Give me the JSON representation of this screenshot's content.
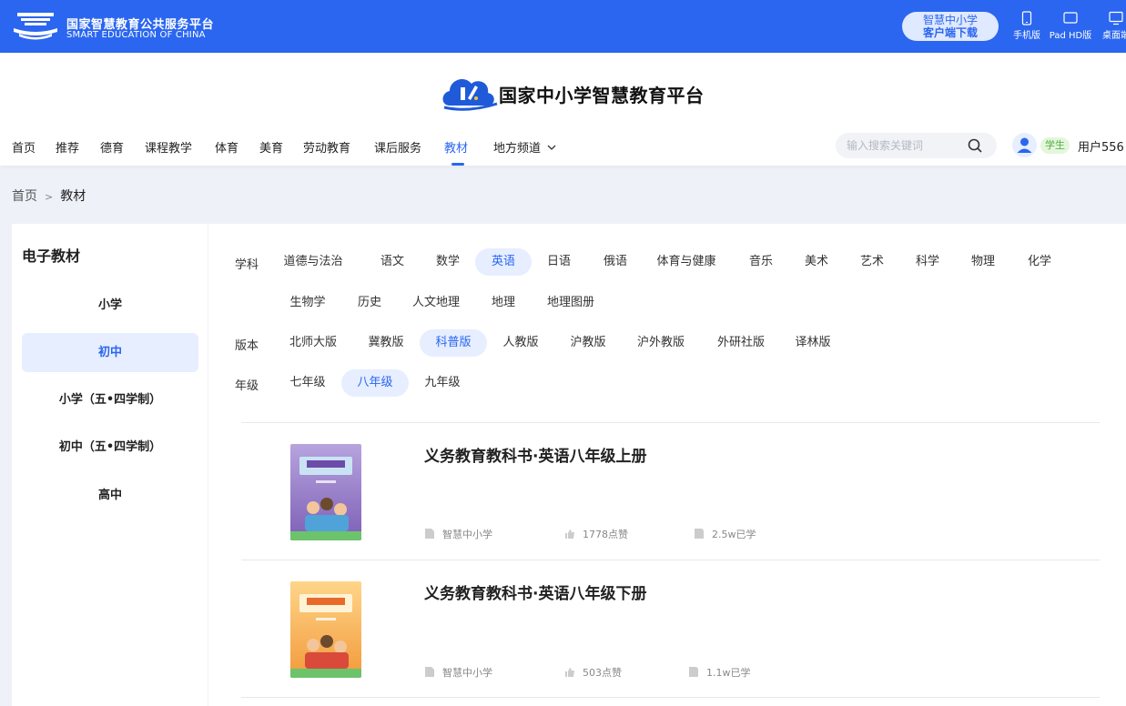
{
  "topbar": {
    "logo_cn": "国家智慧教育公共服务平台",
    "logo_en": "SMART EDUCATION OF CHINA",
    "download_line1": "智慧中小学",
    "download_line2": "客户端下载",
    "devices": [
      {
        "label": "手机版",
        "icon": "phone-icon"
      },
      {
        "label": "Pad HD版",
        "icon": "tablet-icon"
      },
      {
        "label": "桌面端",
        "icon": "desktop-icon"
      }
    ]
  },
  "brand": {
    "title": "国家中小学智慧教育平台"
  },
  "nav": {
    "items": [
      "首页",
      "推荐",
      "德育",
      "课程教学",
      "体育",
      "美育",
      "劳动教育",
      "课后服务",
      "教材",
      "地方频道"
    ],
    "active": "教材"
  },
  "search": {
    "placeholder": "输入搜索关键词"
  },
  "user": {
    "role": "学生",
    "name": "用户556"
  },
  "breadcrumb": {
    "home": "首页",
    "separator": ">",
    "current": "教材"
  },
  "sidebar": {
    "title": "电子教材",
    "items": [
      "小学",
      "初中",
      "小学（五•四学制）",
      "初中（五•四学制）",
      "高中"
    ],
    "active": "初中"
  },
  "filters": {
    "subject_label": "学科",
    "subjects": [
      "道德与法治",
      "语文",
      "数学",
      "英语",
      "日语",
      "俄语",
      "体育与健康",
      "音乐",
      "美术",
      "艺术",
      "科学",
      "物理",
      "化学",
      "生物学",
      "历史",
      "人文地理",
      "地理",
      "地理图册"
    ],
    "subject_active": "英语",
    "edition_label": "版本",
    "editions": [
      "北师大版",
      "冀教版",
      "科普版",
      "人教版",
      "沪教版",
      "沪外教版",
      "外研社版",
      "译林版"
    ],
    "edition_active": "科普版",
    "grade_label": "年级",
    "grades": [
      "七年级",
      "八年级",
      "九年级"
    ],
    "grade_active": "八年级"
  },
  "books": [
    {
      "title": "义务教育教科书·英语八年级上册",
      "publisher": "智慧中小学",
      "likes": "1778点赞",
      "learned": "2.5w已学",
      "cover_color": "#8a6fc0"
    },
    {
      "title": "义务教育教科书·英语八年级下册",
      "publisher": "智慧中小学",
      "likes": "503点赞",
      "learned": "1.1w已学",
      "cover_color": "#f2a441"
    }
  ],
  "colors": {
    "primary": "#2b66f0",
    "active_bg": "#e6eeff",
    "page_bg": "#eef1f8"
  }
}
